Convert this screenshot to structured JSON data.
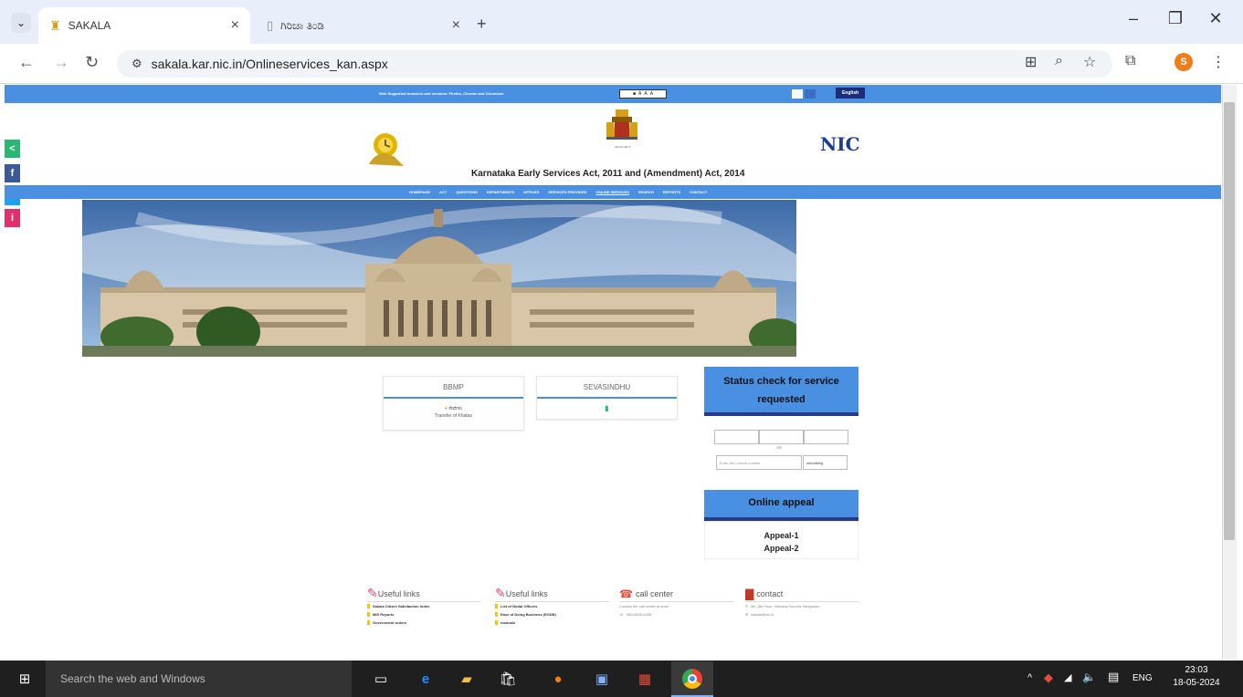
{
  "browser": {
    "tabs": [
      {
        "title": "SAKALA"
      },
      {
        "title": "ಗಿರಿಜಾ ತಿಂಡಿ"
      }
    ],
    "url": "sakala.kar.nic.in/Onlineservices_kan.aspx",
    "profile_initial": "S"
  },
  "page": {
    "top_strip_text": "Web Supported browsers and versions: Firefox, Chrome and Chromium",
    "language_button": "English",
    "act_title": "Karnataka Early Services Act, 2011 and (Amendment) Act, 2014",
    "nic_logo": "NIC",
    "emblem_caption": "ಕರ್ನಾಟಕ ಸರ್ಕಾರ",
    "nav_items": [
      "HOMEPAGE",
      "ACT",
      "QUESTIONS",
      "DEPARTMENTS",
      "OFFICES",
      "SERVICES PROVIDED",
      "ONLINE SERVICES",
      "SEARCH",
      "REPORTS",
      "CONTACT"
    ],
    "social": [
      "<",
      "f",
      "t",
      "i"
    ],
    "bbmp_card": {
      "title": "BBMP",
      "link": "ಸೇವೆಗಳು",
      "sub": "Transfer of Khatas"
    },
    "sevasindhu_card": {
      "title": "SEVASINDHU"
    },
    "status_box": {
      "title": "Status check for service requested",
      "or_text": "OR",
      "placeholder": "Enter the Unique number",
      "submit": "submitting"
    },
    "appeal_box": {
      "title": "Online appeal",
      "links": [
        "Appeal-1",
        "Appeal-2"
      ]
    },
    "footer": {
      "col1": {
        "title": "Useful links",
        "items": [
          "Sakala Citizen Satisfaction Index",
          "MIS Reports",
          "Government orders"
        ]
      },
      "col2": {
        "title": "Useful links",
        "items": [
          "List of Nodal Officers",
          "Ease of Doing Business (EODB)",
          "manuals"
        ]
      },
      "col3": {
        "title": "call center",
        "text": "Contact the call center at least",
        "phone": "080-4455-4455"
      },
      "col4": {
        "title": "contact",
        "address": "4th, 8th Floor, Vidhana Soudha, Bengaluru",
        "email": "sakala@nic.in"
      }
    }
  },
  "taskbar": {
    "search_placeholder": "Search the web and Windows",
    "lang": "ENG",
    "time": "23:03",
    "date": "18-05-2024"
  },
  "colors": {
    "accent_blue": "#4a90e2",
    "dark_blue": "#263a8a",
    "taskbar": "#1f1f1f"
  }
}
